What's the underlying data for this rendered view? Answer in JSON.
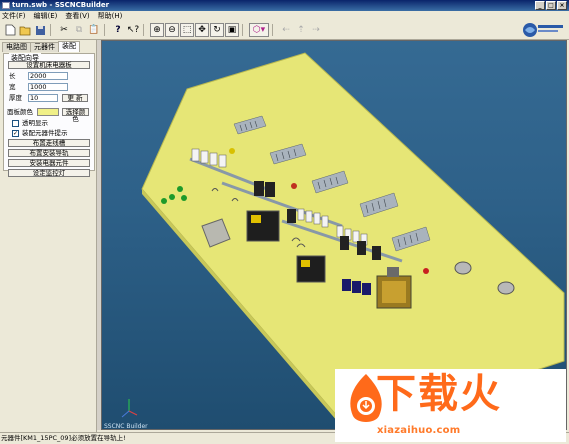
{
  "window": {
    "title": "turn.swb - SSCNCBuilder"
  },
  "menu": [
    "文件(F)",
    "编辑(E)",
    "查看(V)",
    "帮助(H)"
  ],
  "left_panel": {
    "tabs": [
      "电路图",
      "元器件",
      "装配"
    ],
    "active_tab": "装配",
    "group_title": "装配向导",
    "set_board_button": "设置机床电器板",
    "length_label": "长",
    "length_value": "2000",
    "width_label": "宽",
    "width_value": "1000",
    "thickness_label": "厚度",
    "thickness_value": "10",
    "update_button": "更 新",
    "board_color_label": "面板颜色",
    "board_color": "#f0f088",
    "select_color_button": "选择颜色",
    "transparent_label": "透明显示",
    "transparent_checked": false,
    "hint_label": "装配元器件提示",
    "hint_checked": true,
    "action_buttons": [
      "布置走线槽",
      "布置安装导轨",
      "安装电器元件",
      "设定监控灯"
    ]
  },
  "viewport": {
    "background": "#2e6189",
    "board_color": "#e6e676",
    "corner_label": "SSCNC Builder"
  },
  "status": {
    "text": "元器件[KM1_15PC_09]必须放置在导轨上!"
  },
  "logo_text": "南京斯沃数控科技有限公司",
  "watermark": {
    "main": "下载火",
    "sub": "xiazaihuo.com"
  }
}
